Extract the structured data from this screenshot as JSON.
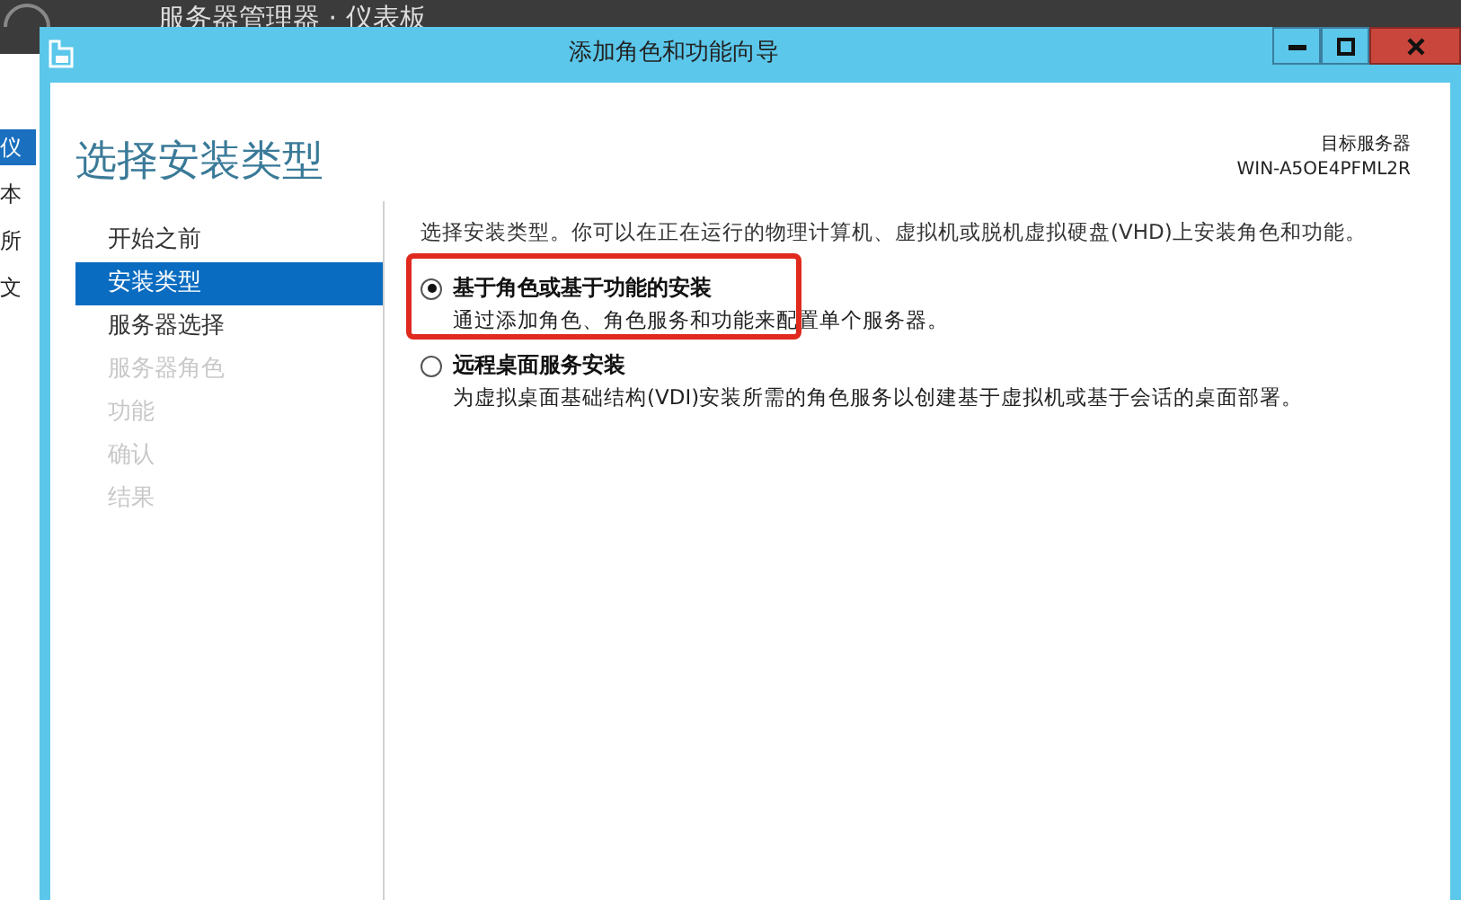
{
  "background": {
    "title": "服务器管理器 · 仪表板",
    "sidebar": [
      {
        "label": "仪",
        "selected": true
      },
      {
        "label": "本",
        "selected": false
      },
      {
        "label": "所",
        "selected": false
      },
      {
        "label": "文",
        "selected": false
      }
    ]
  },
  "window": {
    "title": "添加角色和功能向导"
  },
  "page": {
    "heading": "选择安装类型",
    "target_label": "目标服务器",
    "target_server": "WIN-A5OE4PFML2R"
  },
  "steps": [
    {
      "label": "开始之前",
      "selected": false,
      "disabled": false
    },
    {
      "label": "安装类型",
      "selected": true,
      "disabled": false
    },
    {
      "label": "服务器选择",
      "selected": false,
      "disabled": false
    },
    {
      "label": "服务器角色",
      "selected": false,
      "disabled": true
    },
    {
      "label": "功能",
      "selected": false,
      "disabled": true
    },
    {
      "label": "确认",
      "selected": false,
      "disabled": true
    },
    {
      "label": "结果",
      "selected": false,
      "disabled": true
    }
  ],
  "intro": "选择安装类型。你可以在正在运行的物理计算机、虚拟机或脱机虚拟硬盘(VHD)上安装角色和功能。",
  "options": [
    {
      "label": "基于角色或基于功能的安装",
      "description": "通过添加角色、角色服务和功能来配置单个服务器。",
      "selected": true,
      "highlighted": true
    },
    {
      "label": "远程桌面服务安装",
      "description": "为虚拟桌面基础结构(VDI)安装所需的角色服务以创建基于虚拟机或基于会话的桌面部署。",
      "selected": false,
      "highlighted": false
    }
  ]
}
